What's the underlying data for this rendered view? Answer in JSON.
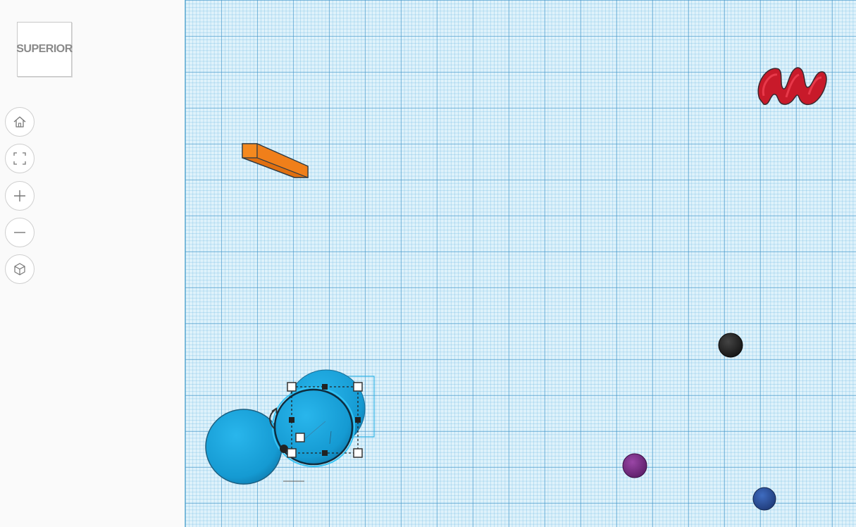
{
  "viewcube": {
    "face_label": "SUPERIOR"
  },
  "nav_controls": [
    {
      "name": "home-view-button",
      "icon": "home-icon"
    },
    {
      "name": "fit-all-button",
      "icon": "fit-view-icon"
    },
    {
      "name": "zoom-in-button",
      "icon": "plus-icon"
    },
    {
      "name": "zoom-out-button",
      "icon": "minus-icon"
    },
    {
      "name": "projection-toggle-button",
      "icon": "cube-icon"
    }
  ],
  "colors": {
    "workplane": "#dff2fb",
    "grid_major": "#4696c8",
    "shape_blue": "#1aa3d9",
    "shape_orange": "#f07f1a",
    "shape_red": "#d32030",
    "sphere_black": "#2a2a2a",
    "sphere_purple": "#7a2f86",
    "sphere_navy": "#2c4f9a"
  },
  "scene_objects": [
    {
      "name": "orange-box",
      "type": "box",
      "color": "orange"
    },
    {
      "name": "red-squiggle-shape",
      "type": "text-shape",
      "color": "red"
    },
    {
      "name": "black-sphere",
      "type": "sphere",
      "color": "black"
    },
    {
      "name": "purple-sphere",
      "type": "sphere",
      "color": "purple"
    },
    {
      "name": "navy-sphere",
      "type": "sphere",
      "color": "navy"
    },
    {
      "name": "blue-sphere-left",
      "type": "sphere",
      "color": "blue"
    },
    {
      "name": "blue-sphere-selected",
      "type": "sphere",
      "color": "blue",
      "selected": true
    }
  ]
}
